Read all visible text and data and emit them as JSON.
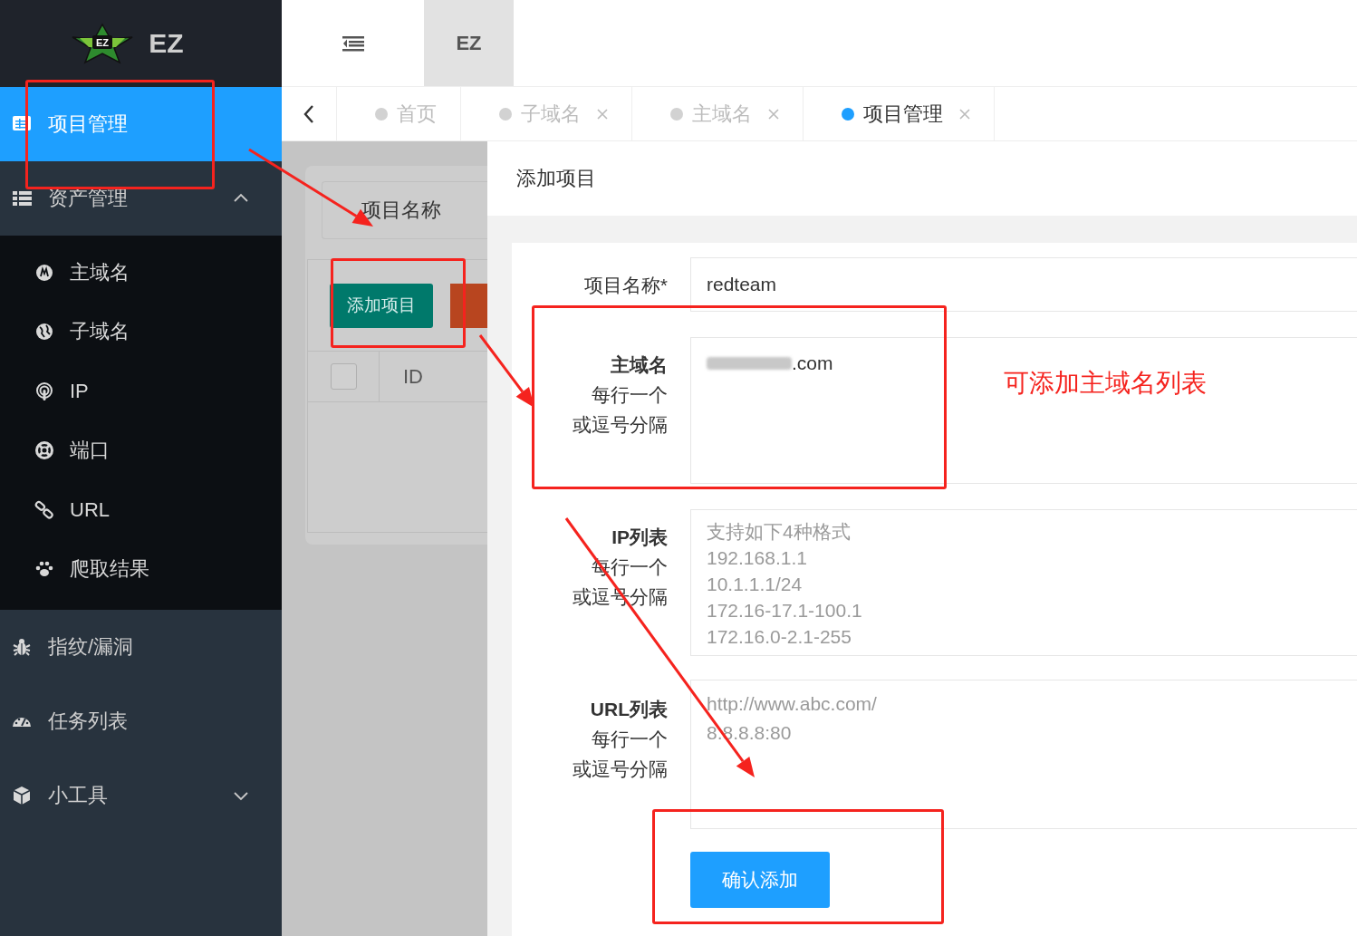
{
  "sidebar": {
    "logo": {
      "badge": "EZ",
      "title": "EZ"
    },
    "items": [
      {
        "kind": "link",
        "label": "项目管理",
        "selected": true
      },
      {
        "kind": "group",
        "label": "资产管理",
        "selected": false,
        "expanded": true,
        "children": [
          {
            "label": "主域名",
            "selected": false
          },
          {
            "label": "子域名",
            "selected": false
          },
          {
            "label": "IP",
            "selected": false
          },
          {
            "label": "端口",
            "selected": false
          },
          {
            "label": "URL",
            "selected": false
          },
          {
            "label": "爬取结果",
            "selected": false
          }
        ]
      },
      {
        "kind": "link",
        "label": "指纹/漏洞",
        "selected": false
      },
      {
        "kind": "link",
        "label": "任务列表",
        "selected": false
      },
      {
        "kind": "group",
        "label": "小工具",
        "selected": false,
        "expanded": false
      }
    ]
  },
  "header": {
    "tab": "EZ"
  },
  "tabs": [
    {
      "label": "首页",
      "selected": false,
      "closable": false
    },
    {
      "label": "子域名",
      "selected": false,
      "closable": true
    },
    {
      "label": "主域名",
      "selected": false,
      "closable": true
    },
    {
      "label": "项目管理",
      "selected": true,
      "closable": true
    }
  ],
  "page": {
    "search": {
      "placeholder": "项目名称"
    },
    "add_button": "添加项目",
    "table": {
      "columns": [
        "ID"
      ],
      "select_all": false
    }
  },
  "drawer": {
    "title": "添加项目",
    "fields": [
      {
        "kind": "input",
        "label": "项目名称*",
        "value": "redteam"
      },
      {
        "kind": "redacted_textarea",
        "label": "主域名",
        "hints": [
          "每行一个",
          "或逗号分隔"
        ],
        "value": ".com"
      },
      {
        "kind": "textarea",
        "label": "IP列表",
        "hints": [
          "每行一个",
          "或逗号分隔"
        ],
        "placeholder": "支持如下4种格式\n192.168.1.1\n10.1.1.1/24\n172.16-17.1-100.1\n172.16.0-2.1-255"
      },
      {
        "kind": "textarea",
        "label": "URL列表",
        "hints": [
          "每行一个",
          "或逗号分隔"
        ],
        "placeholder": "http://www.abc.com/\n8.8.8.8:80"
      }
    ],
    "submit": "确认添加"
  },
  "annotation": {
    "note": "可添加主域名列表"
  }
}
